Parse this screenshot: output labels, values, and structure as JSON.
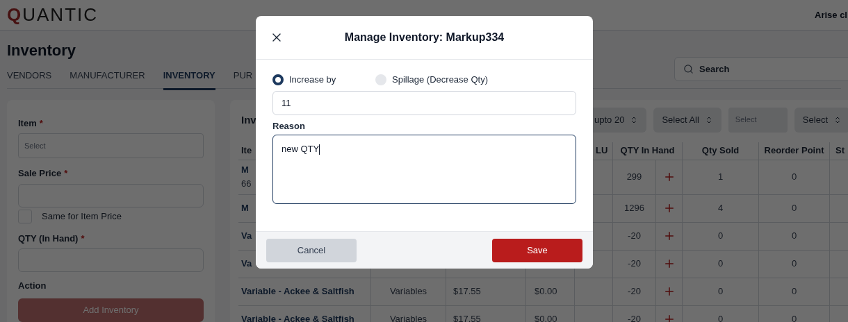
{
  "header": {
    "brand": "QUANTIC",
    "user": "Arise cl"
  },
  "page": {
    "title": "Inventory"
  },
  "tabs": [
    {
      "label": "VENDORS",
      "selected": false
    },
    {
      "label": "MANUFACTURER",
      "selected": false
    },
    {
      "label": "INVENTORY",
      "selected": true
    },
    {
      "label": "PUR",
      "selected": false
    }
  ],
  "search": {
    "placeholder": "Search"
  },
  "form": {
    "fields": [
      {
        "kind": "select",
        "label": "Item",
        "mark": "*",
        "placeholder": "Select"
      },
      {
        "kind": "input",
        "label": "Sale Price",
        "mark": "*"
      },
      {
        "kind": "checkbox",
        "label": "Same for Item Price",
        "checked": false
      },
      {
        "kind": "input",
        "label": "QTY (In Hand)",
        "mark": "*"
      }
    ],
    "action_label": "Action",
    "button": "Add Inventory"
  },
  "table": {
    "title": "Inv",
    "filters": [
      {
        "kind": "dropdown",
        "label": "upto 20"
      },
      {
        "kind": "dropdown",
        "label": "Select All"
      },
      {
        "kind": "field",
        "placeholder": "Select"
      },
      {
        "kind": "dropdown",
        "label": "Select"
      }
    ],
    "columns": {
      "item": "Ite",
      "plu": "LU",
      "qty_in_hand": "QTY In Hand",
      "qty_sold": "Qty Sold",
      "reorder_point": "Reorder Point",
      "stock": "St"
    },
    "rows": [
      {
        "item": "M",
        "item_line2": "66",
        "qty_in_hand": "299",
        "qty_sold": "1",
        "reorder_point": "0"
      },
      {
        "item": "M",
        "qty_in_hand": "1296",
        "qty_sold": "4",
        "reorder_point": "0"
      },
      {
        "item": "Va",
        "qty_in_hand": "-20",
        "qty_sold": "0",
        "reorder_point": "0"
      },
      {
        "item": "Va",
        "qty_in_hand": "-20",
        "qty_sold": "0",
        "reorder_point": "0"
      },
      {
        "item": "Variable - Ackee & Saltfish",
        "category": "Variables",
        "price": "$17.55",
        "cost": "$0.00",
        "qty_in_hand": "-20",
        "qty_sold": "0",
        "reorder_point": "0"
      },
      {
        "item": "Variable - Ackee & Saltfish",
        "category": "Variables",
        "price": "$17.55",
        "cost": "$0.00",
        "qty_in_hand": "-20",
        "qty_sold": "0",
        "reorder_point": "0"
      }
    ]
  },
  "modal": {
    "title": "Manage Inventory: Markup334",
    "options": [
      {
        "label": "Increase by",
        "selected": true
      },
      {
        "label": "Spillage (Decrease Qty)",
        "selected": false
      }
    ],
    "quantity": {
      "value": "11"
    },
    "reason": {
      "label": "Reason",
      "value": "new QTY",
      "focused": true
    },
    "buttons": [
      {
        "kind": "secondary",
        "label": "Cancel"
      },
      {
        "kind": "primary",
        "label": "Save"
      }
    ]
  }
}
